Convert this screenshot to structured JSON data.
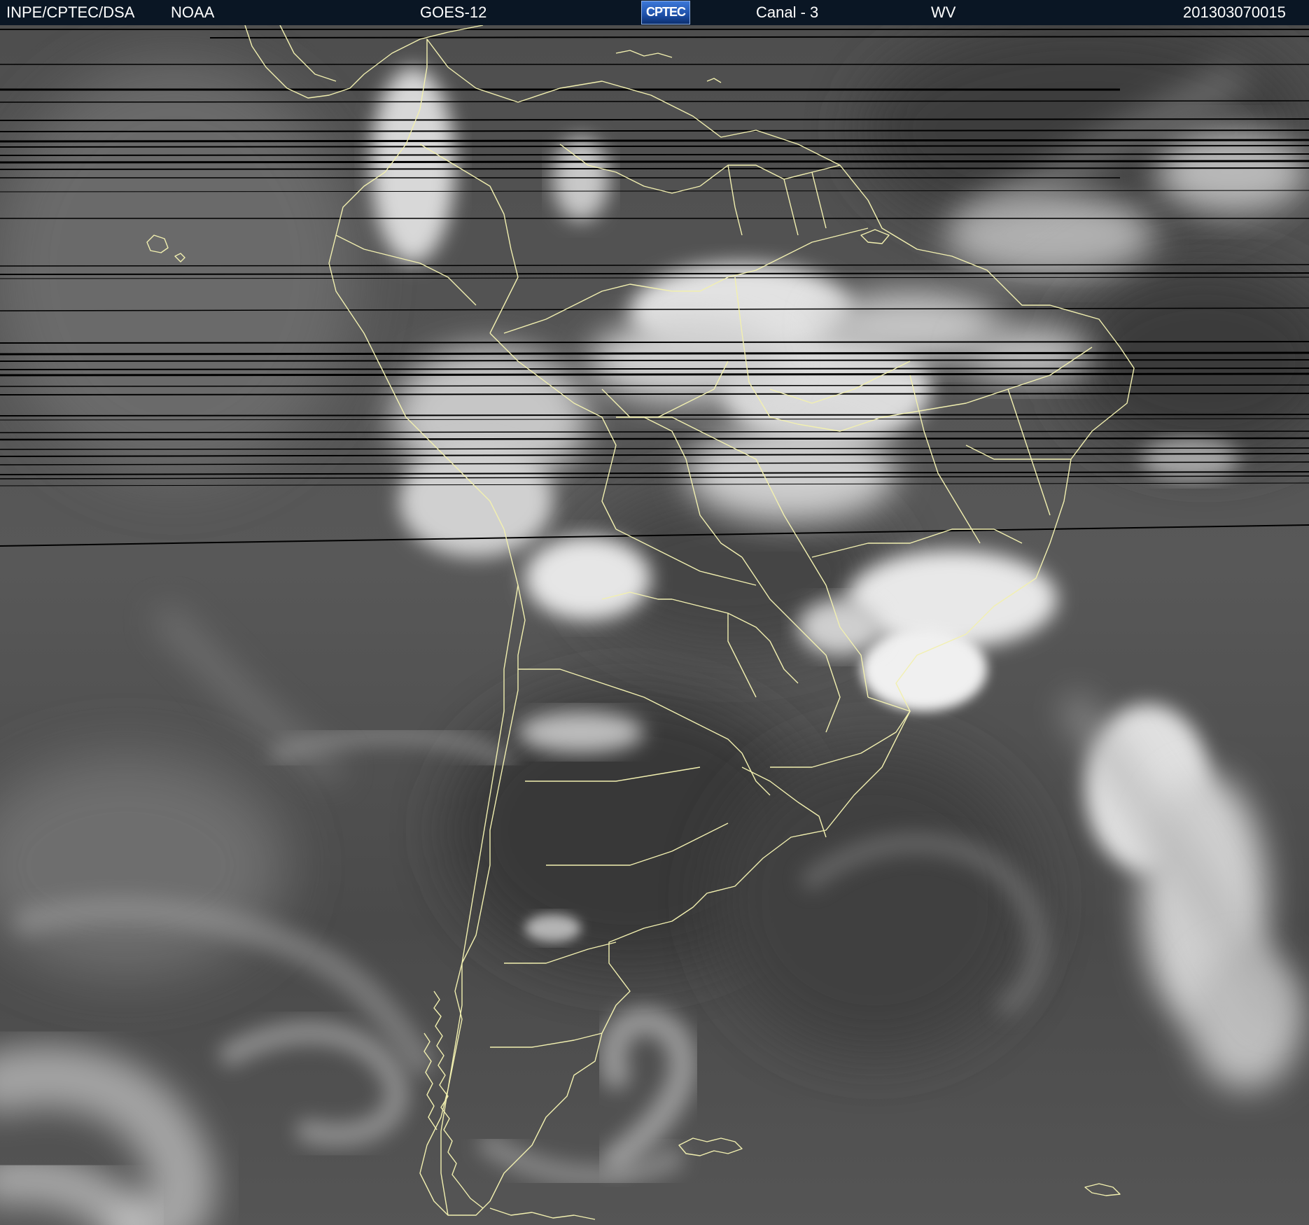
{
  "header": {
    "institution": "INPE/CPTEC/DSA",
    "agency": "NOAA",
    "satellite": "GOES-12",
    "logo_text": "CPTEC",
    "channel": "Canal - 3",
    "band": "WV",
    "timestamp": "201303070015"
  },
  "colors": {
    "header_background": "#0a1624",
    "header_text": "#ffffff",
    "coastline": "#f2f0b0",
    "logo": "#2a5cc0"
  },
  "image": {
    "type": "satellite-water-vapor",
    "palette": "grayscale"
  }
}
